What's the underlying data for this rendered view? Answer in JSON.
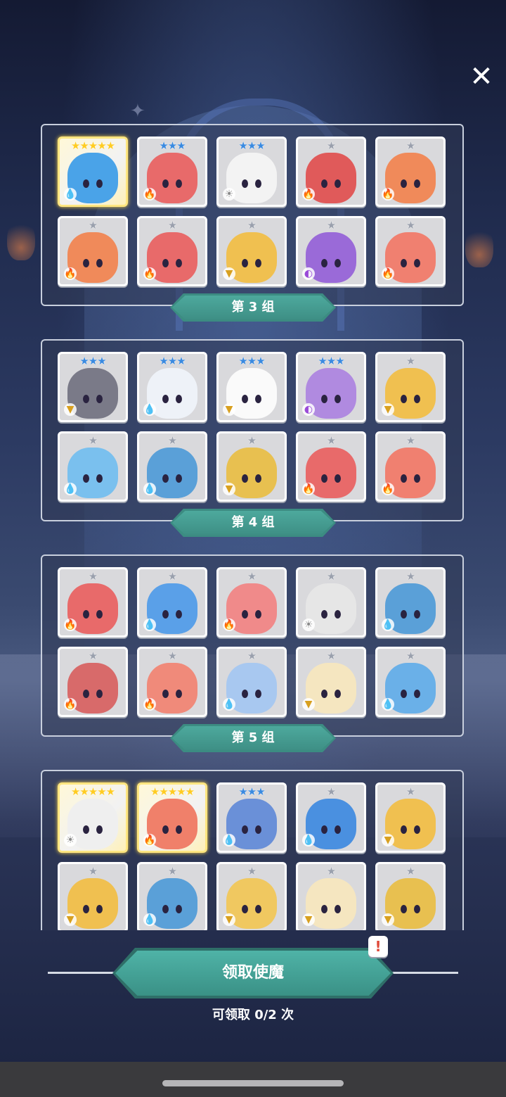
{
  "close_label": "✕",
  "groups_visible": [
    {
      "tab_label": null
    },
    {
      "tab_label": "第 3 组"
    },
    {
      "tab_label": "第 4 组"
    },
    {
      "tab_label": "第 5 组"
    }
  ],
  "tabs": [
    "第 3 组",
    "第 4 组",
    "第 5 组"
  ],
  "panels": [
    [
      {
        "stars": 5,
        "element": "water",
        "color": "#4aa3e8",
        "gold": true
      },
      {
        "stars": 3,
        "element": "fire",
        "color": "#e86a6a"
      },
      {
        "stars": 3,
        "element": "light",
        "color": "#f3f3f3"
      },
      {
        "stars": 1,
        "element": "fire",
        "color": "#e05a5a"
      },
      {
        "stars": 1,
        "element": "fire",
        "color": "#f08a5a"
      },
      {
        "stars": 1,
        "element": "fire",
        "color": "#f08a5a"
      },
      {
        "stars": 1,
        "element": "fire",
        "color": "#e86a6a"
      },
      {
        "stars": 1,
        "element": "earth",
        "color": "#f0c050"
      },
      {
        "stars": 1,
        "element": "dark",
        "color": "#9a6ad8"
      },
      {
        "stars": 1,
        "element": "fire",
        "color": "#f08070"
      }
    ],
    [
      {
        "stars": 3,
        "element": "earth",
        "color": "#7a7a88"
      },
      {
        "stars": 3,
        "element": "water",
        "color": "#eef2f8"
      },
      {
        "stars": 3,
        "element": "earth",
        "color": "#fafafa"
      },
      {
        "stars": 3,
        "element": "dark",
        "color": "#b08ae0"
      },
      {
        "stars": 1,
        "element": "earth",
        "color": "#f0c050"
      },
      {
        "stars": 1,
        "element": "water",
        "color": "#7ac0ee"
      },
      {
        "stars": 1,
        "element": "water",
        "color": "#5aa0d8"
      },
      {
        "stars": 1,
        "element": "earth",
        "color": "#e8c050"
      },
      {
        "stars": 1,
        "element": "fire",
        "color": "#e86a6a"
      },
      {
        "stars": 1,
        "element": "fire",
        "color": "#f08070"
      }
    ],
    [
      {
        "stars": 1,
        "element": "fire",
        "color": "#e86a6a"
      },
      {
        "stars": 1,
        "element": "water",
        "color": "#5aa0e8"
      },
      {
        "stars": 1,
        "element": "fire",
        "color": "#f08a8a"
      },
      {
        "stars": 1,
        "element": "light",
        "color": "#e6e6e6"
      },
      {
        "stars": 1,
        "element": "water",
        "color": "#5aa0d8"
      },
      {
        "stars": 1,
        "element": "fire",
        "color": "#d86a6a"
      },
      {
        "stars": 1,
        "element": "fire",
        "color": "#f08a7a"
      },
      {
        "stars": 1,
        "element": "water",
        "color": "#a8c8f0"
      },
      {
        "stars": 1,
        "element": "earth",
        "color": "#f5e6c0"
      },
      {
        "stars": 1,
        "element": "water",
        "color": "#6ab0e8"
      }
    ],
    [
      {
        "stars": 5,
        "element": "light",
        "color": "#efefef",
        "gold": true
      },
      {
        "stars": 5,
        "element": "fire",
        "color": "#f0806a",
        "gold": true
      },
      {
        "stars": 3,
        "element": "water",
        "color": "#6a90d8"
      },
      {
        "stars": 1,
        "element": "water",
        "color": "#4a90e0"
      },
      {
        "stars": 1,
        "element": "earth",
        "color": "#f0c050"
      },
      {
        "stars": 1,
        "element": "earth",
        "color": "#f0c050"
      },
      {
        "stars": 1,
        "element": "water",
        "color": "#5aa0d8"
      },
      {
        "stars": 1,
        "element": "earth",
        "color": "#f0c860"
      },
      {
        "stars": 1,
        "element": "earth",
        "color": "#f5e6c0"
      },
      {
        "stars": 1,
        "element": "earth",
        "color": "#e8c050"
      }
    ]
  ],
  "claim_button_label": "领取使魔",
  "claim_badge": "!",
  "claim_count_text": "可领取 0/2 次",
  "element_icons": {
    "water": "💧",
    "fire": "🔥",
    "light": "☀",
    "earth": "▼",
    "dark": "◐"
  },
  "element_colors": {
    "water": "#2b7fd6",
    "fire": "#e0452e",
    "light": "#8a8a8a",
    "earth": "#d8a020",
    "dark": "#9a4ad8"
  },
  "star_colors": {
    "gold": "#ffcc22",
    "blue": "#3a8ae0",
    "silver": "#9aa0ad"
  }
}
